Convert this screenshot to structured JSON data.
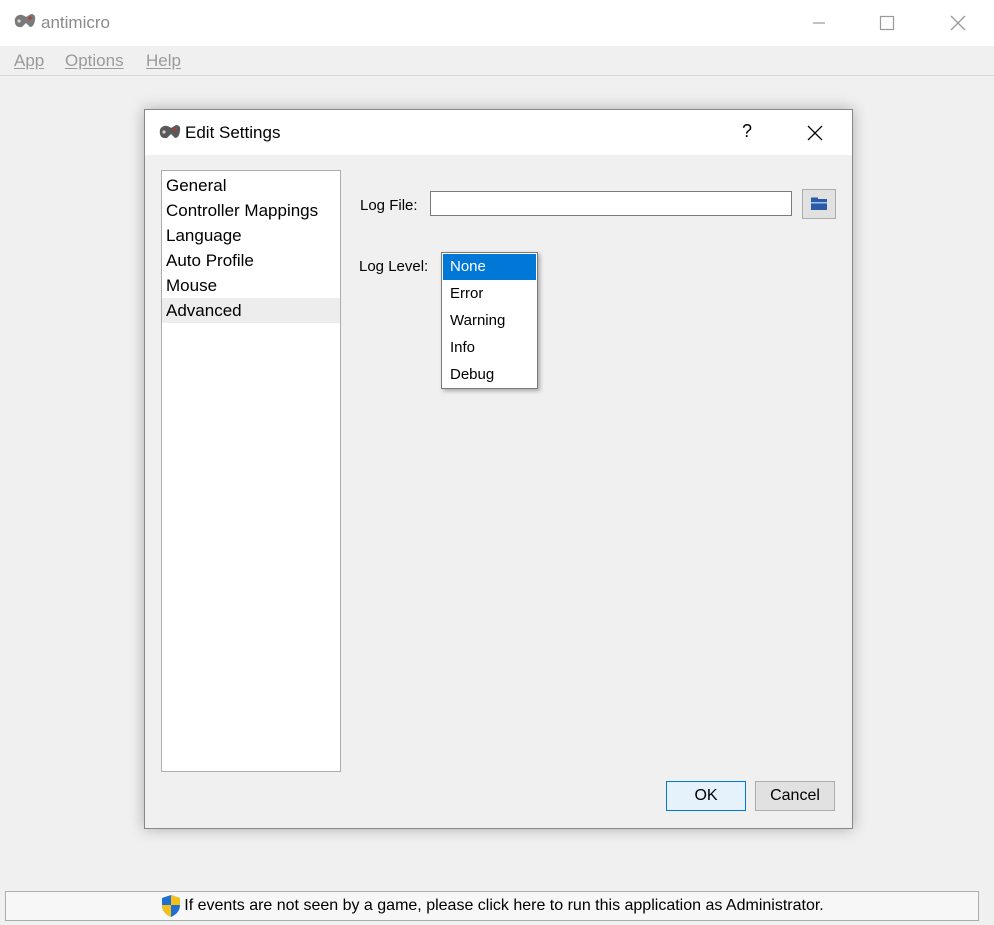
{
  "window": {
    "title": "antimicro",
    "minimize_icon": "minimize-icon",
    "maximize_icon": "maximize-icon",
    "close_icon": "close-icon"
  },
  "menubar": {
    "items": [
      {
        "label": "App"
      },
      {
        "label": "Options"
      },
      {
        "label": "Help"
      }
    ]
  },
  "dialog": {
    "title": "Edit Settings",
    "help_label": "?",
    "nav": {
      "items": [
        {
          "label": "General"
        },
        {
          "label": "Controller Mappings"
        },
        {
          "label": "Language"
        },
        {
          "label": "Auto Profile"
        },
        {
          "label": "Mouse"
        },
        {
          "label": "Advanced"
        }
      ],
      "selected": "Advanced"
    },
    "log_file": {
      "label": "Log File:",
      "value": ""
    },
    "log_level": {
      "label": "Log Level:",
      "options": [
        {
          "label": "None"
        },
        {
          "label": "Error"
        },
        {
          "label": "Warning"
        },
        {
          "label": "Info"
        },
        {
          "label": "Debug"
        }
      ],
      "selected": "None"
    },
    "ok_label": "OK",
    "cancel_label": "Cancel"
  },
  "status": {
    "message": "If events are not seen by a game, please click here to run this application as Administrator."
  },
  "colors": {
    "selection": "#0078d7",
    "background": "#f0f0f0"
  }
}
